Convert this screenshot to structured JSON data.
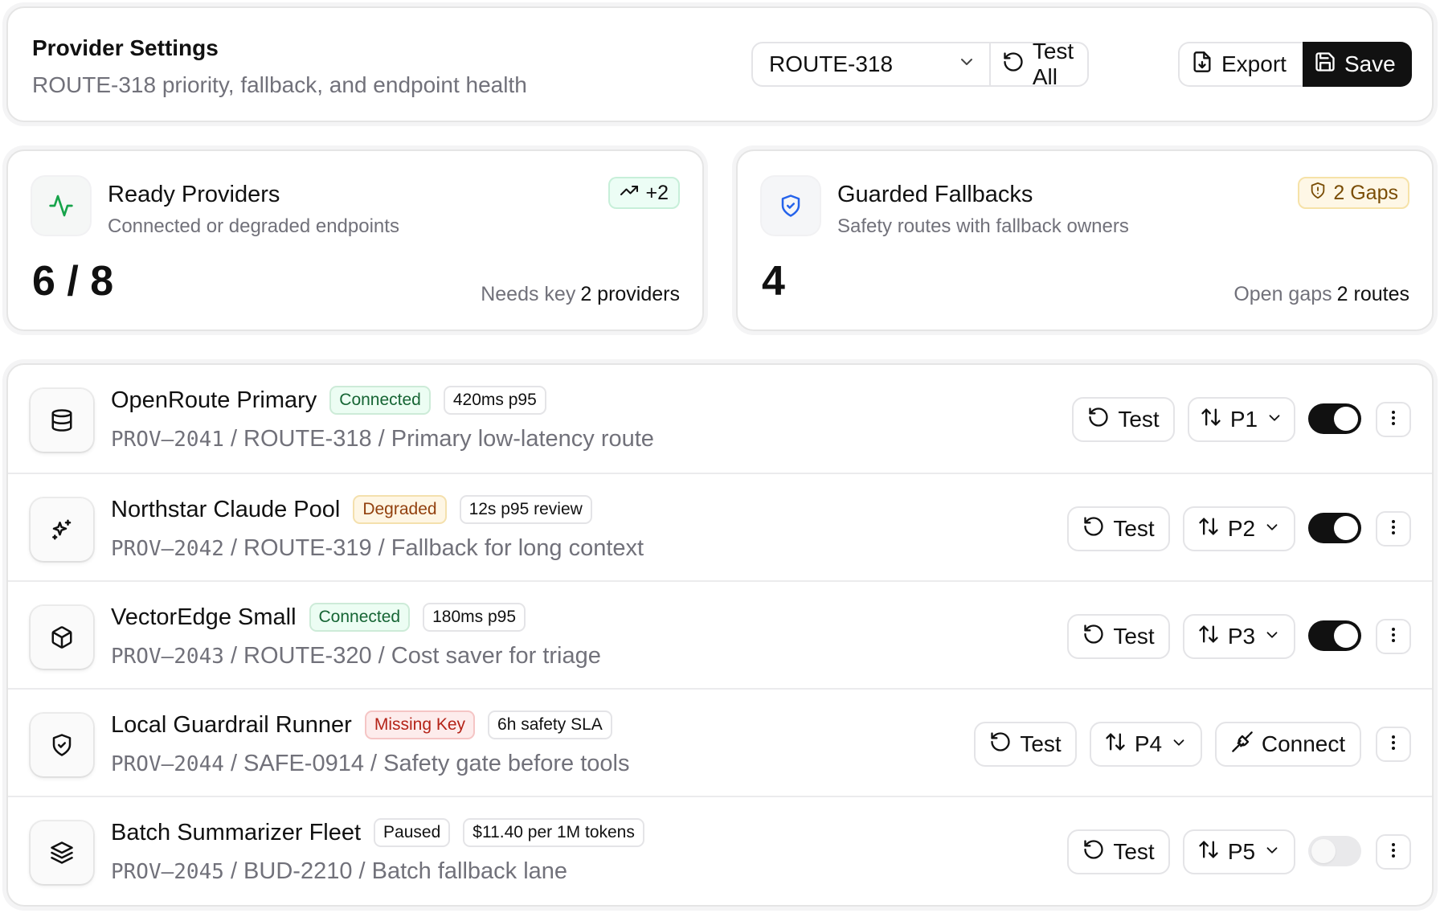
{
  "header": {
    "title": "Provider Settings",
    "subtitle": "ROUTE-318 priority, fallback, and endpoint health",
    "route_select": "ROUTE-318",
    "test_all_label": "Test All",
    "export_label": "Export",
    "save_label": "Save"
  },
  "stats": {
    "ready": {
      "title": "Ready Providers",
      "subtitle": "Connected or degraded endpoints",
      "badge": "+2",
      "value": "6 / 8",
      "foot_label": "Needs key",
      "foot_value": "2 providers"
    },
    "fallbacks": {
      "title": "Guarded Fallbacks",
      "subtitle": "Safety routes with fallback owners",
      "badge": "2 Gaps",
      "value": "4",
      "foot_label": "Open gaps",
      "foot_value": "2 routes"
    }
  },
  "providers": [
    {
      "name": "OpenRoute Primary",
      "status": "Connected",
      "meta": "420ms p95",
      "id": "PROV–2041",
      "detail": " / ROUTE-318 / Primary low-latency route",
      "test_label": "Test",
      "priority": "P1",
      "enabled": true
    },
    {
      "name": "Northstar Claude Pool",
      "status": "Degraded",
      "meta": "12s p95 review",
      "id": "PROV–2042",
      "detail": " / ROUTE-319 / Fallback for long context",
      "test_label": "Test",
      "priority": "P2",
      "enabled": true
    },
    {
      "name": "VectorEdge Small",
      "status": "Connected",
      "meta": "180ms p95",
      "id": "PROV–2043",
      "detail": " / ROUTE-320 / Cost saver for triage",
      "test_label": "Test",
      "priority": "P3",
      "enabled": true
    },
    {
      "name": "Local Guardrail Runner",
      "status": "Missing Key",
      "meta": "6h safety SLA",
      "id": "PROV–2044",
      "detail": " / SAFE-0914 / Safety gate before tools",
      "test_label": "Test",
      "priority": "P4",
      "connect_label": "Connect"
    },
    {
      "name": "Batch Summarizer Fleet",
      "status": "Paused",
      "meta": "$11.40 per 1M tokens",
      "id": "PROV–2045",
      "detail": " / BUD-2210 / Batch fallback lane",
      "test_label": "Test",
      "priority": "P5",
      "enabled": false
    }
  ],
  "icons": {
    "route_select": "chevron-down-icon",
    "test_all": "refresh-icon",
    "export": "file-download-icon",
    "save": "save-icon",
    "ready": "activity-icon",
    "ready_badge": "trending-up-icon",
    "fallbacks": "shield-check-icon",
    "fallbacks_badge": "shield-alert-icon",
    "provider_icons": [
      "database-icon",
      "sparkles-icon",
      "box-icon",
      "shield-check-icon",
      "layers-icon"
    ],
    "priority": "arrows-up-down-icon",
    "connect": "plug-icon",
    "more": "more-vertical-icon"
  },
  "colors": {
    "accent": "#111111",
    "connected": "#166534",
    "degraded": "#92400e",
    "missing": "#b42318",
    "activity_green": "#16a34a",
    "shield_blue": "#2563eb"
  }
}
